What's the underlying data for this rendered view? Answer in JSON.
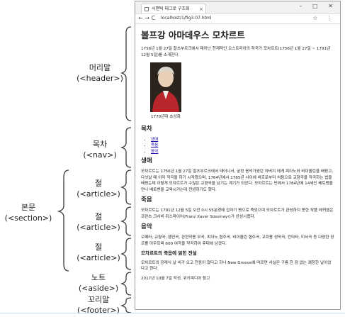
{
  "labels": {
    "header": {
      "name": "머리말",
      "tag": "(<header>)"
    },
    "nav": {
      "name": "목차",
      "tag": "(<nav>)"
    },
    "section": {
      "name": "본문",
      "tag": "(<section>)"
    },
    "article1": {
      "name": "절",
      "tag": "(<article>)"
    },
    "article2": {
      "name": "절",
      "tag": "(<article>)"
    },
    "article3": {
      "name": "절",
      "tag": "(<article>)"
    },
    "aside": {
      "name": "노트",
      "tag": "(<aside>)"
    },
    "footer": {
      "name": "꼬리말",
      "tag": "(<footer>)"
    }
  },
  "browser": {
    "tab_title": "시맨틱 태그로 구조화",
    "tab_close": "×",
    "url": "localhost/1/fig3-07.html",
    "window_controls": "– □ ✕",
    "nav_buttons": "← → C",
    "addr_icons": "☆ ⋮"
  },
  "page": {
    "title": "볼프강 아마데우스 모차르트",
    "intro": "1756년 1월 27일 잘츠부르크에서 태어난 천재적인 오스트리아의 작곡가 모차르트(1756년 1월 27일 ~ 1791년 12월 5일)를 소개한다.",
    "caption": "1770년대 초상화",
    "nav_title": "목차",
    "nav_items": [
      "생애",
      "죽음",
      "음악"
    ],
    "sec1_title": "생애",
    "sec1_text": "모차르트는 1756년 1월 27일 잘츠부르크에서 태어나서, 궁정 음악가였던 아버지 에게 피아노와 바이올린을 배웠고, 다섯살 때 이미 작곡을 하기 시작했으며, 1764년에서 1765년 사이에 바흐로부터 처음으로 교향곡을 작곡하는 법을 배웠는데 이렇게 모차르트가 수많은 교향곡을 남기는 계기가 되었다. 모차르트는 빈에서 1784년에 14세인 베토벤을 만나 베토벤을 교육시키는데 전념하기도 했다.",
    "sec2_title": "죽음",
    "sec2_text": "모차르트는 1791년 12월 5일 오전 0시 55분경에 갑자기 병으로 죽었으며 모차르트가 완성하지 못한 작품 레퀴엠은 프란츠 크사버 쥐스마이어(Franz Xaver Süssmayr)가 완성시켰다.",
    "sec3_title": "음악",
    "sec3_text": "오페라, 교향곡, 행진곡, 관현악용 무곡, 피아노 협주곡, 바이올린 협주곡, 교회용 성악곡, 칸타타, 미사곡 등 다양한 장르를 아우르며 600 여곡을 작곡하여 후대에 남겼다.",
    "aside_title": "모차르트의 죽음에 얽힌 전설",
    "aside_text": "모차르트의 장례식 날 비가 오고 천둥이 쳤다고 하나 New Groove에 따르면 사실은 구름 한 점 없는 쾌청한 날이었다고 한다.",
    "footer": "2017년 10월 7일 작성, 위키피디아 참고"
  },
  "colors": {
    "brace": "#3a3a3a",
    "link": "#1a0dab",
    "coat": "#b8252b"
  }
}
